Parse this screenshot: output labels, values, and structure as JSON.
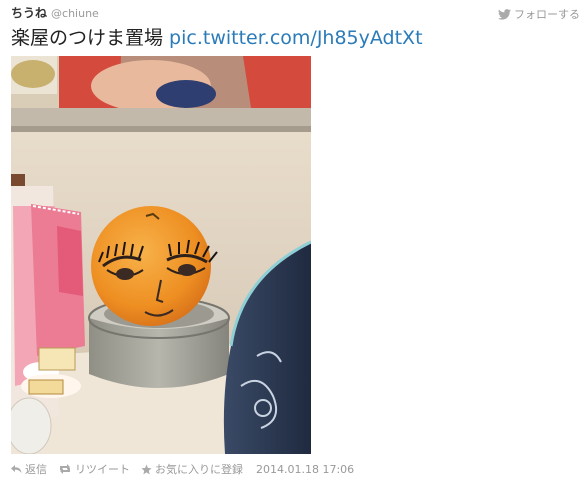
{
  "tweet": {
    "display_name": "ちうね",
    "username": "@chiune",
    "follow_label": "フォローする",
    "text": "楽屋のつけま置場 ",
    "link": "pic.twitter.com/Jh85yAdtXt",
    "photo_icon": "photo-mandarin-orange-with-eyelashes",
    "actions": {
      "reply_label": "返信",
      "reply_icon": "reply-arrow-icon",
      "retweet_label": "リツイート",
      "retweet_icon": "retweet-icon",
      "favorite_label": "お気に入りに登録",
      "favorite_icon": "star-icon"
    },
    "timestamp": "2014.01.18 17:06"
  },
  "colors": {
    "link": "#2b7bb9",
    "muted": "#999999",
    "text": "#222222"
  }
}
